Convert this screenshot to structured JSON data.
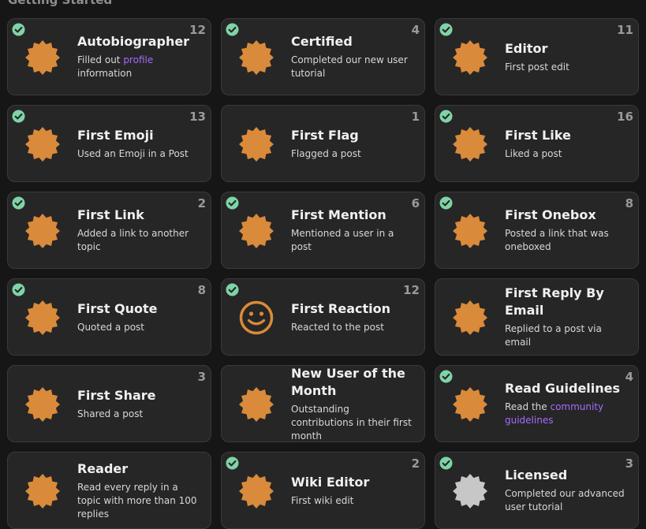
{
  "section_title": "Getting Started",
  "colors": {
    "badge": "#d98a3a",
    "badge_gray": "#c7c7c7",
    "check": "#7fd3a8"
  },
  "badges": [
    {
      "name": "Autobiographer",
      "desc_before": "Filled out ",
      "desc_link": "profile",
      "desc_after": " information",
      "count": "12",
      "granted": true,
      "icon": "badge-icon"
    },
    {
      "name": "Certified",
      "desc_before": "Completed our new user tutorial",
      "desc_link": "",
      "desc_after": "",
      "count": "4",
      "granted": true,
      "icon": "badge-icon"
    },
    {
      "name": "Editor",
      "desc_before": "First post edit",
      "desc_link": "",
      "desc_after": "",
      "count": "11",
      "granted": true,
      "icon": "badge-icon"
    },
    {
      "name": "First Emoji",
      "desc_before": "Used an Emoji in a Post",
      "desc_link": "",
      "desc_after": "",
      "count": "13",
      "granted": true,
      "icon": "badge-icon"
    },
    {
      "name": "First Flag",
      "desc_before": "Flagged a post",
      "desc_link": "",
      "desc_after": "",
      "count": "1",
      "granted": false,
      "icon": "badge-icon"
    },
    {
      "name": "First Like",
      "desc_before": "Liked a post",
      "desc_link": "",
      "desc_after": "",
      "count": "16",
      "granted": true,
      "icon": "badge-icon"
    },
    {
      "name": "First Link",
      "desc_before": "Added a link to another topic",
      "desc_link": "",
      "desc_after": "",
      "count": "2",
      "granted": true,
      "icon": "badge-icon"
    },
    {
      "name": "First Mention",
      "desc_before": "Mentioned a user in a post",
      "desc_link": "",
      "desc_after": "",
      "count": "6",
      "granted": true,
      "icon": "badge-icon"
    },
    {
      "name": "First Onebox",
      "desc_before": "Posted a link that was oneboxed",
      "desc_link": "",
      "desc_after": "",
      "count": "8",
      "granted": true,
      "icon": "badge-icon"
    },
    {
      "name": "First Quote",
      "desc_before": "Quoted a post",
      "desc_link": "",
      "desc_after": "",
      "count": "8",
      "granted": true,
      "icon": "badge-icon"
    },
    {
      "name": "First Reaction",
      "desc_before": "Reacted to the post",
      "desc_link": "",
      "desc_after": "",
      "count": "12",
      "granted": true,
      "icon": "smile-icon"
    },
    {
      "name": "First Reply By Email",
      "desc_before": "Replied to a post via email",
      "desc_link": "",
      "desc_after": "",
      "count": "",
      "granted": false,
      "icon": "badge-icon"
    },
    {
      "name": "First Share",
      "desc_before": "Shared a post",
      "desc_link": "",
      "desc_after": "",
      "count": "3",
      "granted": false,
      "icon": "badge-icon"
    },
    {
      "name": "New User of the Month",
      "desc_before": "Outstanding contributions in their first month",
      "desc_link": "",
      "desc_after": "",
      "count": "",
      "granted": false,
      "icon": "badge-icon"
    },
    {
      "name": "Read Guidelines",
      "desc_before": "Read the ",
      "desc_link": "community guidelines",
      "desc_after": "",
      "count": "4",
      "granted": true,
      "icon": "badge-icon"
    },
    {
      "name": "Reader",
      "desc_before": "Read every reply in a topic with more than 100 replies",
      "desc_link": "",
      "desc_after": "",
      "count": "",
      "granted": false,
      "icon": "badge-icon"
    },
    {
      "name": "Wiki Editor",
      "desc_before": "First wiki edit",
      "desc_link": "",
      "desc_after": "",
      "count": "2",
      "granted": true,
      "icon": "badge-icon"
    },
    {
      "name": "Licensed",
      "desc_before": "Completed our advanced user tutorial",
      "desc_link": "",
      "desc_after": "",
      "count": "3",
      "granted": true,
      "icon": "badge-gray-icon"
    }
  ]
}
